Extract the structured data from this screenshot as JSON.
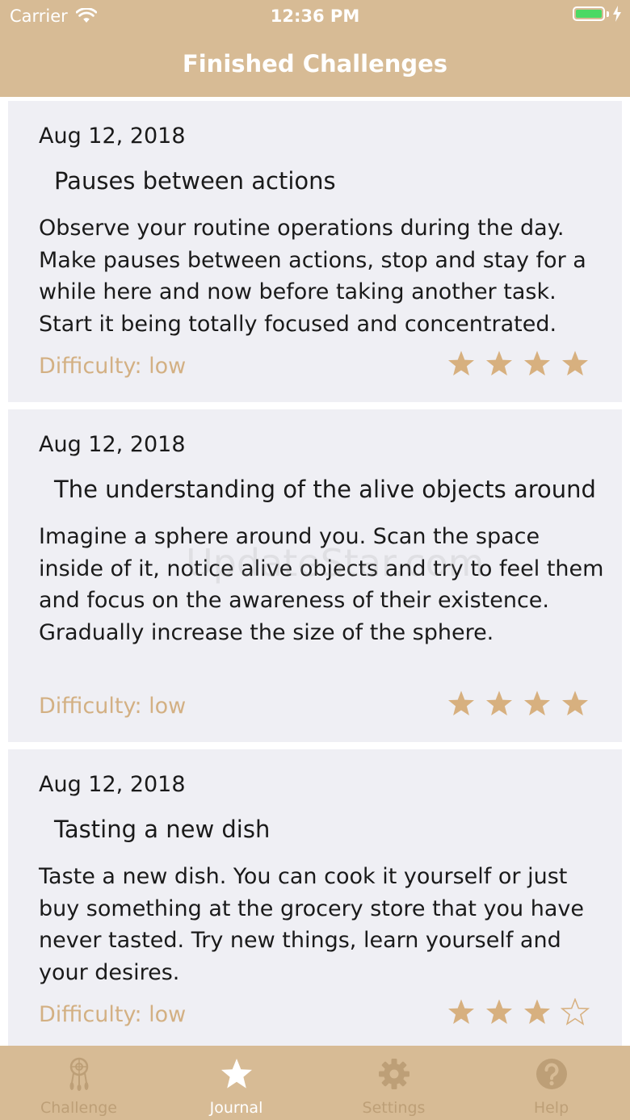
{
  "status_bar": {
    "carrier": "Carrier",
    "time": "12:36 PM",
    "battery_level": 1.0,
    "battery_color": "#4cd964"
  },
  "nav": {
    "title": "Finished Challenges"
  },
  "colors": {
    "accent": "#d7bb95",
    "star": "#d7b07f",
    "difficulty": "#d3b083",
    "card_bg": "#efeff4",
    "tab_inactive": "#bd9f77",
    "tab_active": "#ffffff"
  },
  "challenges": [
    {
      "date": "Aug 12, 2018",
      "title": "Pauses between actions",
      "description": "Observe your routine operations during the day. Make pauses between actions, stop and stay for a while here and now before taking another task. Start it being totally focused and concentrated.",
      "difficulty": "Difficulty: low",
      "rating": 4,
      "rating_max": 4
    },
    {
      "date": "Aug 12, 2018",
      "title": "The understanding of the alive objects around",
      "description": "Imagine a sphere around you. Scan the space inside of it, notice alive objects and try to feel them and focus on the awareness of their existence. Gradually increase the size of the sphere.",
      "difficulty": "Difficulty: low",
      "rating": 4,
      "rating_max": 4
    },
    {
      "date": "Aug 12, 2018",
      "title": "Tasting a new dish",
      "description": "Taste a new dish. You can cook it yourself or just buy something at the grocery store that you have never tasted. Try new things, learn yourself and your desires.",
      "difficulty": "Difficulty: low",
      "rating": 3,
      "rating_max": 4
    }
  ],
  "watermark": "UpdateStar.com",
  "tabs": [
    {
      "label": "Challenge",
      "icon": "dreamcatcher-icon",
      "active": false
    },
    {
      "label": "Journal",
      "icon": "star-icon",
      "active": true
    },
    {
      "label": "Settings",
      "icon": "gear-icon",
      "active": false
    },
    {
      "label": "Help",
      "icon": "help-icon",
      "active": false
    }
  ]
}
